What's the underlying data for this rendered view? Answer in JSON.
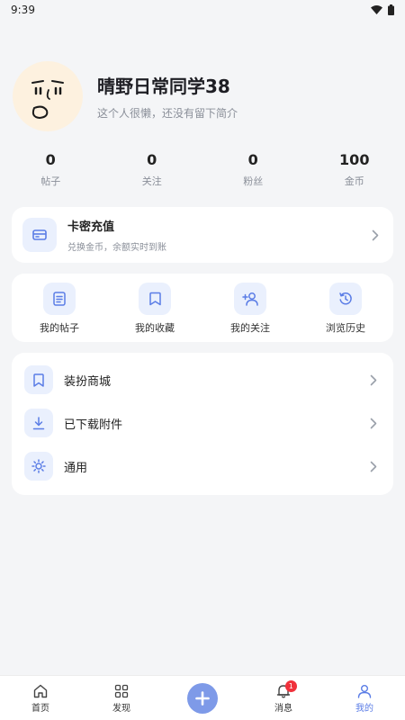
{
  "status_bar": {
    "time": "9:39"
  },
  "profile": {
    "username": "晴野日常同学38",
    "bio": "这个人很懒，还没有留下简介"
  },
  "stats": [
    {
      "value": "0",
      "label": "帖子"
    },
    {
      "value": "0",
      "label": "关注"
    },
    {
      "value": "0",
      "label": "粉丝"
    },
    {
      "value": "100",
      "label": "金币"
    }
  ],
  "recharge": {
    "title": "卡密充值",
    "subtitle": "兑换金币，余额实时到账",
    "icon": "card-icon"
  },
  "quick_actions": [
    {
      "label": "我的帖子",
      "icon": "document-icon"
    },
    {
      "label": "我的收藏",
      "icon": "bookmark-icon"
    },
    {
      "label": "我的关注",
      "icon": "add-user-icon"
    },
    {
      "label": "浏览历史",
      "icon": "history-icon"
    }
  ],
  "menu": [
    {
      "label": "装扮商城",
      "icon": "bookmark-icon"
    },
    {
      "label": "已下载附件",
      "icon": "download-icon"
    },
    {
      "label": "通用",
      "icon": "settings-icon"
    }
  ],
  "tabbar": {
    "items": [
      {
        "label": "首页",
        "icon": "home-icon"
      },
      {
        "label": "发现",
        "icon": "grid-icon"
      },
      {
        "label": "",
        "icon": "plus-icon"
      },
      {
        "label": "消息",
        "icon": "bell-icon",
        "badge": "1"
      },
      {
        "label": "我的",
        "icon": "user-icon"
      }
    ],
    "active_index": 4
  },
  "colors": {
    "accent": "#5b7de6",
    "icon_bg": "#eaf0fd",
    "badge": "#f0313b",
    "background": "#f4f5f7"
  }
}
